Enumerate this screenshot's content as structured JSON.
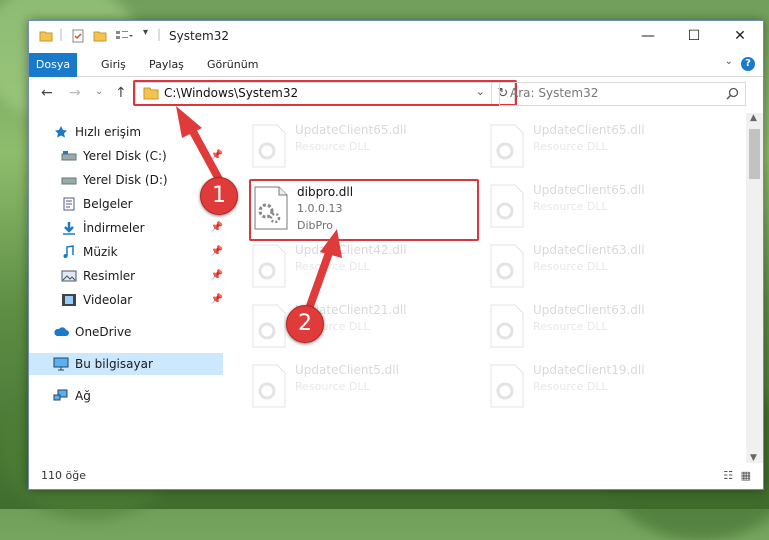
{
  "window": {
    "title": "System32"
  },
  "ribbon": {
    "tabs": [
      "Dosya",
      "Giriş",
      "Paylaş",
      "Görünüm"
    ],
    "help_label": "?"
  },
  "address": {
    "path": "C:\\Windows\\System32"
  },
  "search": {
    "placeholder": "Ara: System32"
  },
  "sidebar": {
    "items": [
      {
        "label": "Hızlı erişim",
        "icon": "star-icon",
        "pinned": false
      },
      {
        "label": "Yerel Disk (C:)",
        "icon": "drive-icon",
        "pinned": true
      },
      {
        "label": "Yerel Disk (D:)",
        "icon": "drive-icon",
        "pinned": false
      },
      {
        "label": "Belgeler",
        "icon": "documents-icon",
        "pinned": true
      },
      {
        "label": "İndirmeler",
        "icon": "download-icon",
        "pinned": true
      },
      {
        "label": "Müzik",
        "icon": "music-icon",
        "pinned": true
      },
      {
        "label": "Resimler",
        "icon": "pictures-icon",
        "pinned": true
      },
      {
        "label": "Videolar",
        "icon": "videos-icon",
        "pinned": true
      },
      {
        "label": "OneDrive",
        "icon": "cloud-icon",
        "pinned": false
      },
      {
        "label": "Bu bilgisayar",
        "icon": "computer-icon",
        "pinned": false
      },
      {
        "label": "Ağ",
        "icon": "network-icon",
        "pinned": false
      }
    ]
  },
  "files": [
    {
      "name": "UpdateClient65.dll",
      "desc": "Resource DLL"
    },
    {
      "name": "UpdateClient65.dll",
      "desc": "Resource DLL"
    },
    {
      "name": "UpdateClient65.dll",
      "desc": "Resource DLL"
    },
    {
      "name": "UpdateClient42.dll",
      "desc": "Resource DLL"
    },
    {
      "name": "UpdateClient63.dll",
      "desc": "Resource DLL"
    },
    {
      "name": "UpdateClient21.dll",
      "desc": "Resource DLL"
    },
    {
      "name": "UpdateClient63.dll",
      "desc": "Resource DLL"
    },
    {
      "name": "UpdateClient5.dll",
      "desc": "Resource DLL"
    },
    {
      "name": "UpdateClient19.dll",
      "desc": "Resource DLL"
    }
  ],
  "selected_file": {
    "name": "dibpro.dll",
    "version": "1.0.0.13",
    "desc": "DibPro"
  },
  "status": {
    "count": "110 öğe"
  },
  "callouts": [
    "1",
    "2"
  ],
  "colors": {
    "accent": "#1979ca",
    "callout": "#e03b3b",
    "selection": "#cce8ff"
  }
}
